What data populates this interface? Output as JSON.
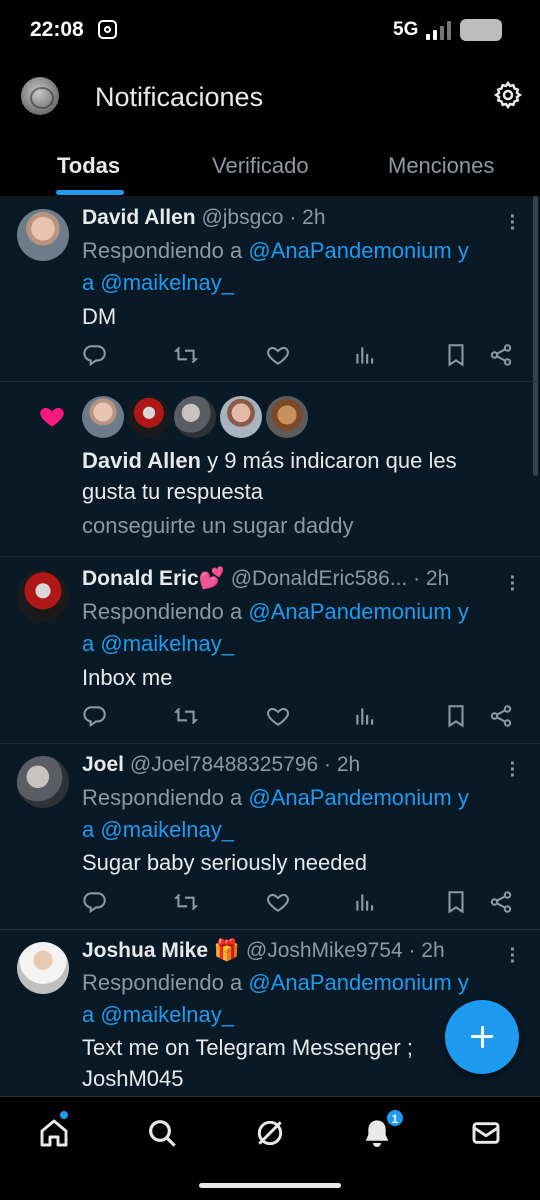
{
  "status_bar": {
    "time": "22:08",
    "network": "5G",
    "battery_percent": 70
  },
  "header": {
    "title": "Notificaciones"
  },
  "tabs": [
    {
      "label": "Todas",
      "active": true
    },
    {
      "label": "Verificado",
      "active": false
    },
    {
      "label": "Menciones",
      "active": false
    }
  ],
  "feed": {
    "items": [
      {
        "type": "reply",
        "name": "David Allen",
        "handle": "@jbsgco",
        "time": "· 2h",
        "reply_prefix": "Respondiendo a",
        "mention1": "@AnaPandemonium",
        "conj": "y",
        "reply_prefix2": "a",
        "mention2": "@maikelnay_",
        "text": [
          "DM"
        ]
      },
      {
        "type": "like",
        "name": "David Allen",
        "summary_rest": "y 9 más indicaron que les",
        "summary_line2": "gusta tu respuesta",
        "context": "conseguirte un sugar daddy"
      },
      {
        "type": "reply",
        "name": "Donald Eric💕",
        "handle": "@DonaldEric586...",
        "time": "· 2h",
        "reply_prefix": "Respondiendo a",
        "mention1": "@AnaPandemonium",
        "conj": "y",
        "reply_prefix2": "a",
        "mention2": "@maikelnay_",
        "text": [
          "Inbox me"
        ]
      },
      {
        "type": "reply",
        "name": "Joel",
        "handle": "@Joel78488325796",
        "time": "· 2h",
        "reply_prefix": "Respondiendo a",
        "mention1": "@AnaPandemonium",
        "conj": "y",
        "reply_prefix2": "a",
        "mention2": "@maikelnay_",
        "text": [
          "Sugar baby seriously needed"
        ]
      },
      {
        "type": "reply",
        "name": "Joshua Mike 🎁",
        "handle": "@JoshMike9754",
        "time": "· 2h",
        "reply_prefix": "Respondiendo a",
        "mention1": "@AnaPandemonium",
        "conj": "y",
        "reply_prefix2": "a",
        "mention2": "@maikelnay_",
        "text": [
          "Text me on Telegram Messenger ;",
          "JoshM045"
        ]
      }
    ]
  },
  "bottom_nav": {
    "items": [
      "home-icon",
      "search-icon",
      "grok-icon",
      "bell-icon",
      "mail-icon"
    ],
    "notification_badge": "1"
  },
  "colors": {
    "accent": "#1d9bf0",
    "feed_bg": "#091926",
    "like": "#f91880"
  }
}
